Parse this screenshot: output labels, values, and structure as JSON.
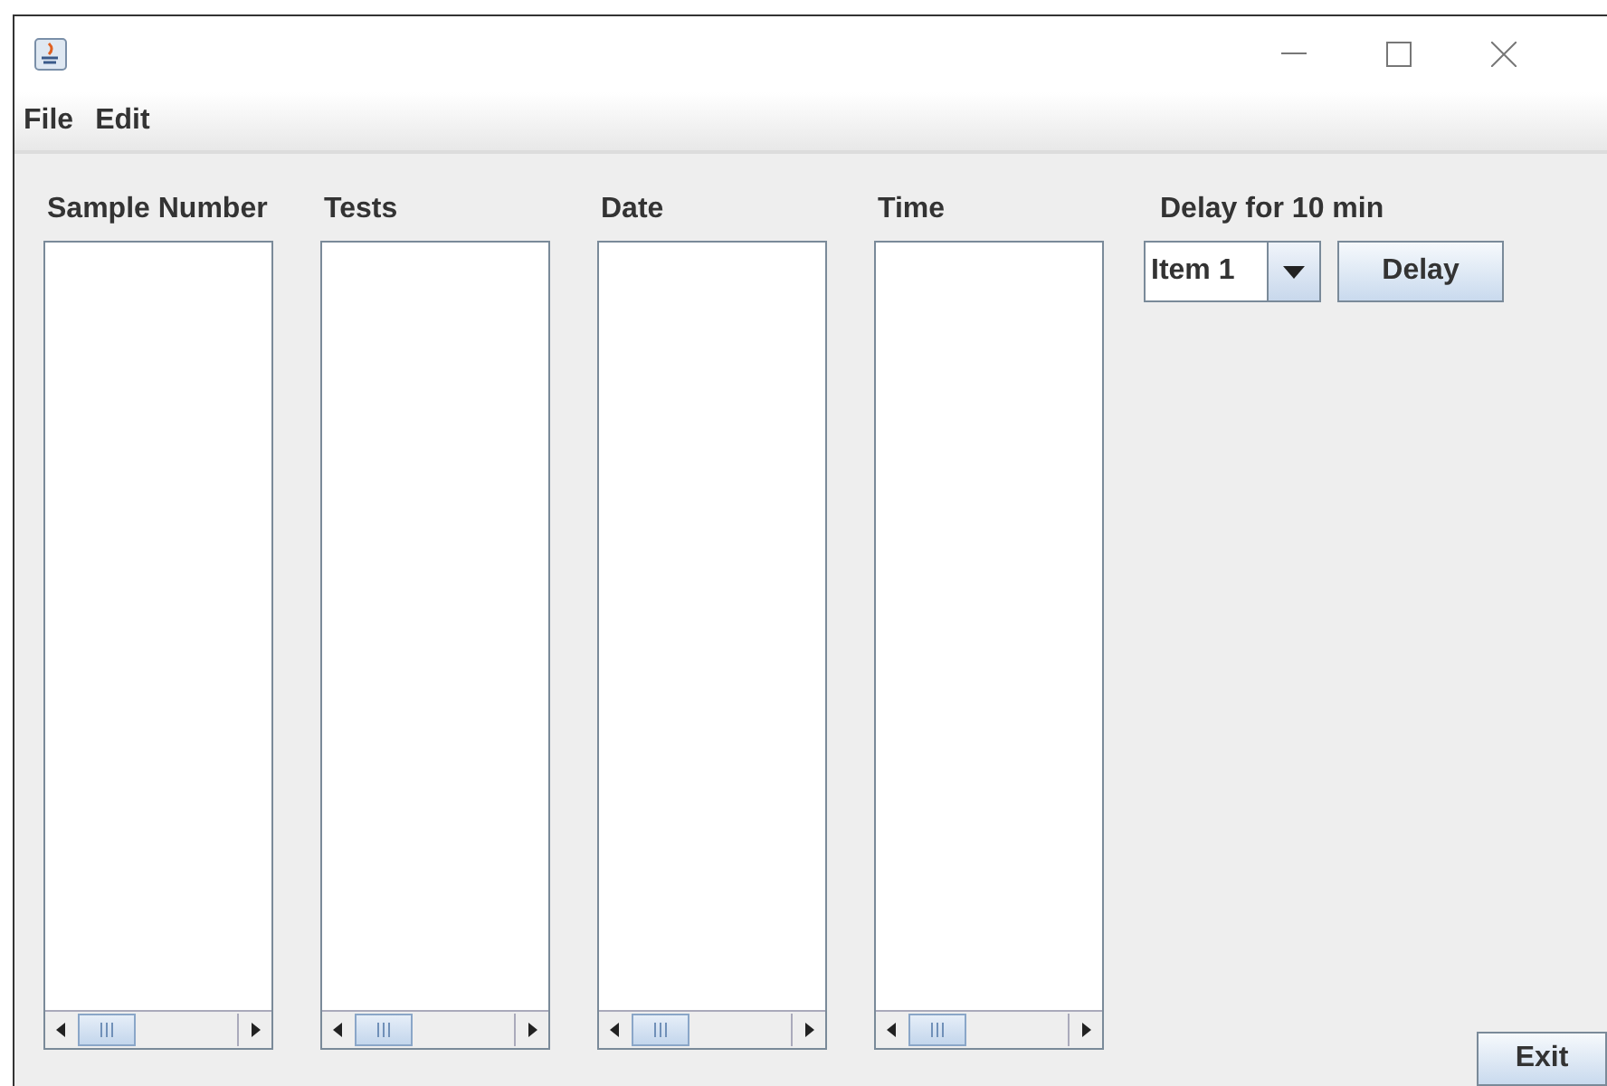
{
  "menu": [
    "File",
    "Edit"
  ],
  "lists": [
    {
      "heading": "Sample Number"
    },
    {
      "heading": "Tests"
    },
    {
      "heading": "Date"
    },
    {
      "heading": "Time"
    }
  ],
  "delay": {
    "label": "Delay for 10 min",
    "combo_value": "Item 1",
    "button": "Delay"
  },
  "exit_button": "Exit"
}
